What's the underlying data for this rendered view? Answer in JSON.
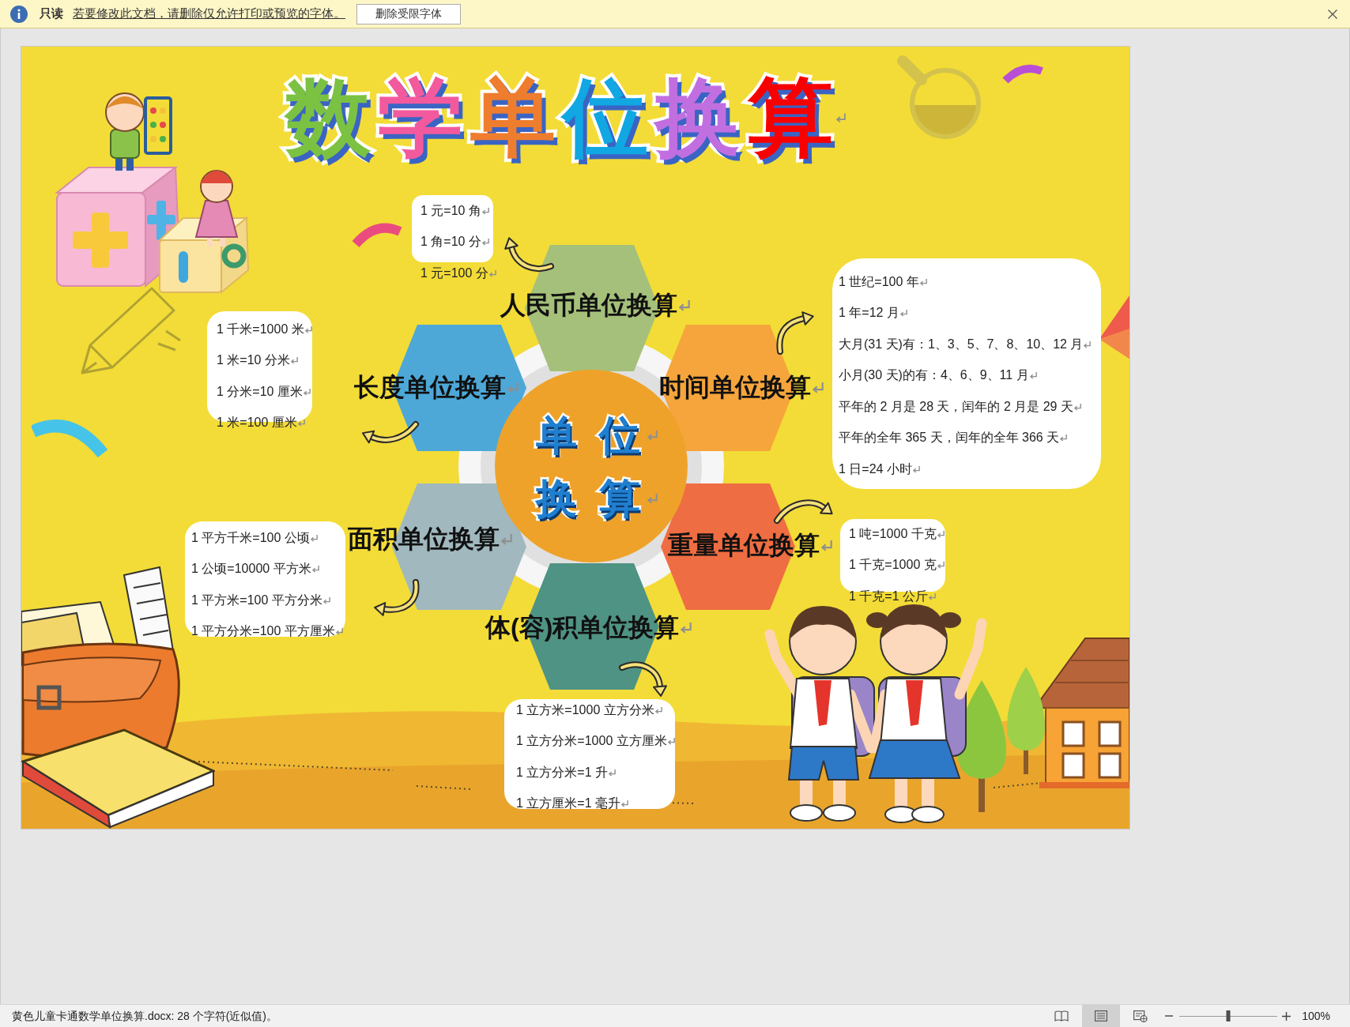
{
  "message_bar": {
    "label": "只读",
    "message": "若要修改此文档，请删除仅允许打印或预览的字体。",
    "button": "删除受限字体"
  },
  "poster": {
    "title": [
      {
        "text": "数",
        "color": "#7cc242"
      },
      {
        "text": "学",
        "color": "#f25a9d"
      },
      {
        "text": "单",
        "color": "#ef7d2e"
      },
      {
        "text": "位",
        "color": "#10a7e3"
      },
      {
        "text": "换",
        "color": "#c16fe0"
      },
      {
        "text": "算",
        "color": "#f80000"
      }
    ],
    "center": [
      "单 位",
      "换 算"
    ],
    "topics": [
      {
        "label": "人民币单位换算",
        "color": "#a5c07a",
        "facts": [
          "1 元=10 角",
          "1 角=10 分",
          "1 元=100 分"
        ]
      },
      {
        "label": "长度单位换算",
        "color": "#4da8d8",
        "facts": [
          "1 千米=1000 米",
          "1 米=10 分米",
          "1 分米=10 厘米",
          "1 米=100 厘米"
        ]
      },
      {
        "label": "时间单位换算",
        "color": "#f6a53c",
        "facts": [
          "1 世纪=100 年",
          "1 年=12 月",
          "大月(31 天)有：1、3、5、7、8、10、12 月",
          "小月(30 天)的有：4、6、9、11 月",
          "平年的 2 月是 28 天，闰年的 2 月是 29 天",
          "平年的全年 365 天，闰年的全年 366 天",
          "1 日=24 小时"
        ]
      },
      {
        "label": "面积单位换算",
        "color": "#a0b8be",
        "facts": [
          "1 平方千米=100 公顷",
          "1 公顷=10000 平方米",
          "1 平方米=100 平方分米",
          "1 平方分米=100 平方厘米"
        ]
      },
      {
        "label": "重量单位换算",
        "color": "#ef6d42",
        "facts": [
          "1 吨=1000 千克",
          "1 千克=1000 克",
          "1 千克=1 公斤"
        ]
      },
      {
        "label": "体(容)积单位换算",
        "color": "#4f9384",
        "facts": [
          "1 立方米=1000 立方分米",
          "1 立方分米=1000 立方厘米",
          "1 立方分米=1 升",
          "1 立方厘米=1 毫升"
        ]
      }
    ]
  },
  "status_bar": {
    "text": "黄色儿童卡通数学单位换算.docx: 28 个字符(近似值)。",
    "views": [
      {
        "kind": "read",
        "selected": false
      },
      {
        "kind": "print",
        "selected": true
      },
      {
        "kind": "web",
        "selected": false
      }
    ],
    "zoom": {
      "level": 0.5,
      "label": "100%"
    }
  }
}
